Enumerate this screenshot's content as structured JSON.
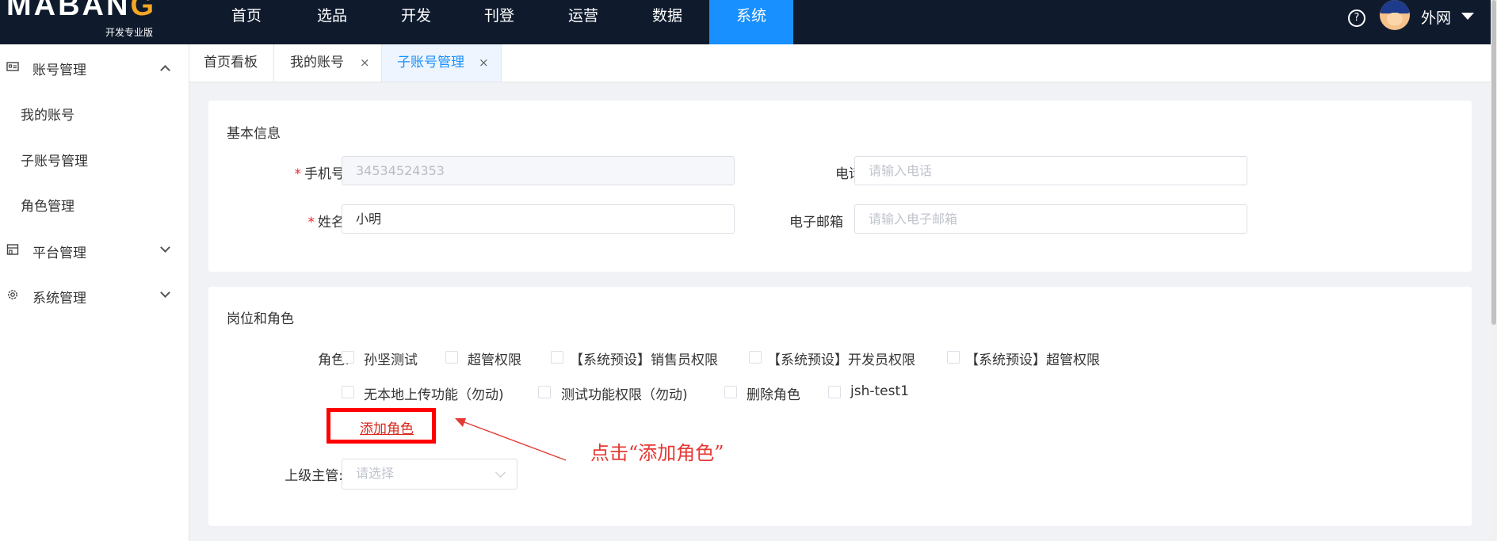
{
  "brand": {
    "logo_text_left": "MABAN",
    "logo_text_accent": "G",
    "logo_sub": "开发专业版"
  },
  "nav": {
    "items": [
      "首页",
      "选品",
      "开发",
      "刊登",
      "运营",
      "数据",
      "系统"
    ],
    "active": "系统"
  },
  "user": {
    "name": "外网",
    "help_icon": "?"
  },
  "sidebar": {
    "account": {
      "label": "账号管理",
      "icon": "id-card-icon"
    },
    "account_children": [
      "我的账号",
      "子账号管理",
      "角色管理"
    ],
    "platform": {
      "label": "平台管理",
      "icon": "store-icon"
    },
    "system": {
      "label": "系统管理",
      "icon": "gear-icon"
    }
  },
  "tabs": [
    {
      "label": "首页看板"
    },
    {
      "label": "我的账号",
      "close": "×"
    },
    {
      "label": "子账号管理",
      "close": "×",
      "active": true
    }
  ],
  "basic_info": {
    "title": "基本信息",
    "required_mark": "*",
    "phone_label": "手机号",
    "phone_value": "34534524353",
    "tel_label": "电话",
    "tel_placeholder": "请输入电话",
    "name_label": "姓名",
    "name_value": "小明",
    "email_label": "电子邮箱",
    "email_placeholder": "请输入电子邮箱"
  },
  "roles_section": {
    "title": "岗位和角色",
    "roles_label": "角色:",
    "roles": [
      "孙坚测试",
      "超管权限",
      "【系统预设】销售员权限",
      "【系统预设】开发员权限",
      "【系统预设】超管权限",
      "无本地上传功能（勿动)",
      "测试功能权限（勿动)",
      "删除角色",
      "jsh-test1"
    ],
    "add_role": "添加角色",
    "supervisor_label": "上级主管:",
    "supervisor_placeholder": "请选择"
  },
  "annotation": {
    "text": "点击“添加角色”",
    "color": "#e53935"
  },
  "colors": {
    "topbar": "#0f1b2d",
    "accent": "#1890ff",
    "highlight": "#ff0000"
  }
}
